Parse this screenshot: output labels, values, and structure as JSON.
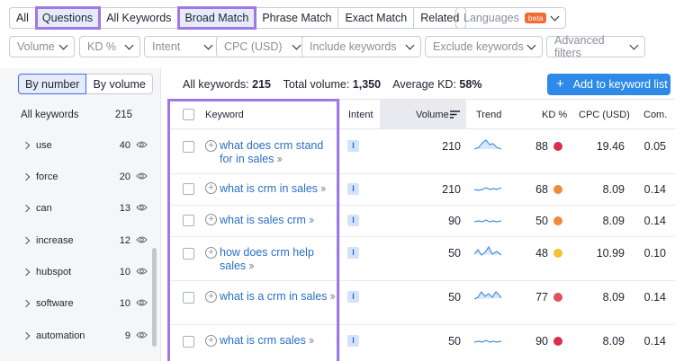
{
  "tabs": [
    {
      "label": "All",
      "active": false,
      "highlight": false
    },
    {
      "label": "Questions",
      "active": true,
      "highlight": true
    },
    {
      "label": "All Keywords",
      "active": false,
      "highlight": false
    },
    {
      "label": "Broad Match",
      "active": true,
      "highlight": true
    },
    {
      "label": "Phrase Match",
      "active": false,
      "highlight": false
    },
    {
      "label": "Exact Match",
      "active": false,
      "highlight": false
    },
    {
      "label": "Related",
      "active": false,
      "highlight": false
    }
  ],
  "languages": {
    "label": "Languages",
    "badge": "beta"
  },
  "filters": [
    "Volume",
    "KD %",
    "Intent",
    "CPC (USD)",
    "Include keywords",
    "Exclude keywords",
    "Advanced filters"
  ],
  "sidebar": {
    "by_number": "By number",
    "by_volume": "By volume",
    "all_label": "All keywords",
    "all_count": "215",
    "groups": [
      {
        "label": "use",
        "count": "40"
      },
      {
        "label": "force",
        "count": "20"
      },
      {
        "label": "can",
        "count": "13"
      },
      {
        "label": "increase",
        "count": "12"
      },
      {
        "label": "hubspot",
        "count": "10"
      },
      {
        "label": "software",
        "count": "10"
      },
      {
        "label": "automation",
        "count": "9"
      }
    ]
  },
  "summary": {
    "all_label": "All keywords:",
    "all_value": "215",
    "volume_label": "Total volume:",
    "volume_value": "1,350",
    "kd_label": "Average KD:",
    "kd_value": "58%"
  },
  "add_button": "Add to keyword list",
  "columns": {
    "keyword": "Keyword",
    "intent": "Intent",
    "volume": "Volume",
    "trend": "Trend",
    "kd": "KD %",
    "cpc": "CPC (USD)",
    "com": "Com."
  },
  "rows": [
    {
      "keyword": "what does crm stand for in sales",
      "intent": "I",
      "volume": "210",
      "kd": "88",
      "kd_color": "#d9304a",
      "cpc": "19.46",
      "com": "0.05"
    },
    {
      "keyword": "what is crm in sales",
      "intent": "I",
      "volume": "210",
      "kd": "68",
      "kd_color": "#ef8a3c",
      "cpc": "8.09",
      "com": "0.14"
    },
    {
      "keyword": "what is sales crm",
      "intent": "I",
      "volume": "90",
      "kd": "50",
      "kd_color": "#ef8a3c",
      "cpc": "8.09",
      "com": "0.14"
    },
    {
      "keyword": "how does crm help sales",
      "intent": "I",
      "volume": "50",
      "kd": "48",
      "kd_color": "#f2c230",
      "cpc": "10.99",
      "com": "0.10"
    },
    {
      "keyword": "what is a crm in sales",
      "intent": "I",
      "volume": "50",
      "kd": "77",
      "kd_color": "#e0505e",
      "cpc": "8.09",
      "com": "0.14"
    },
    {
      "keyword": "what is crm sales",
      "intent": "I",
      "volume": "50",
      "kd": "90",
      "kd_color": "#d9304a",
      "cpc": "8.09",
      "com": "0.14"
    }
  ],
  "colors": {
    "accent": "#2d8ae8",
    "highlight": "#a078e6",
    "link": "#2a6ec8"
  }
}
